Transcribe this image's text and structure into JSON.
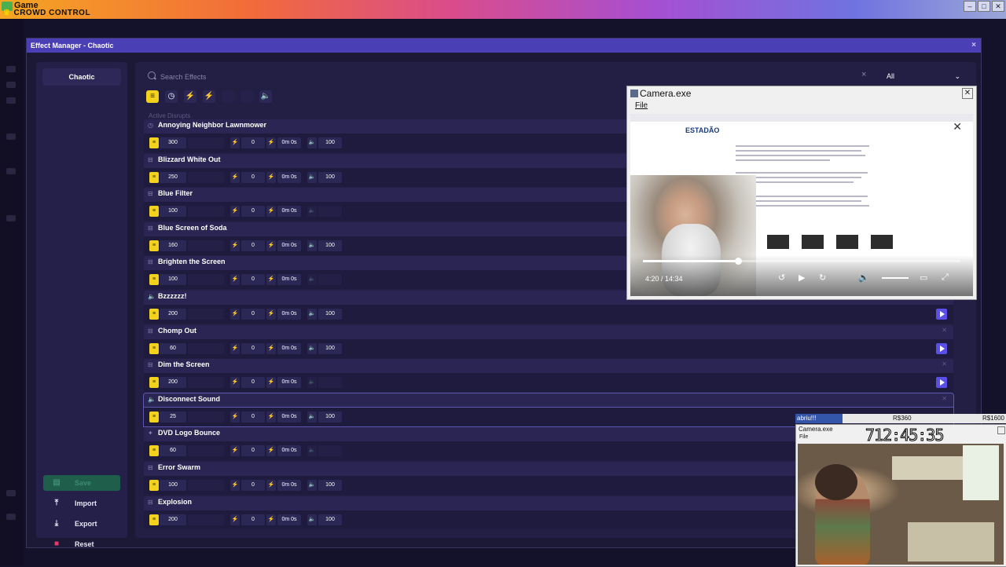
{
  "titlebar": {
    "app_title": "Game",
    "logo_text": "CROWD CONTROL",
    "min": "–",
    "max": "□",
    "close": "✕"
  },
  "effect_manager": {
    "title": "Effect Manager - Chaotic",
    "close_label": "×",
    "mode_label": "Chaotic",
    "search_placeholder": "Search Effects",
    "search_clear": "×",
    "filter_value": "All",
    "section_label": "Active Disrupts",
    "side_actions": {
      "save": "Save",
      "import": "Import",
      "export": "Export",
      "reset": "Reset"
    },
    "rows": [
      {
        "name": "Annoying Neighbor Lawnmower",
        "type_icon": "clock-icon",
        "price": "300",
        "bits": "0",
        "duration": "0m 0s",
        "volume": "100",
        "has_volume": true,
        "has_play": false
      },
      {
        "name": "Blizzard White Out",
        "type_icon": "timer-icon",
        "price": "250",
        "bits": "0",
        "duration": "0m 0s",
        "volume": "100",
        "has_volume": true,
        "has_play": false
      },
      {
        "name": "Blue Filter",
        "type_icon": "timer-icon",
        "price": "100",
        "bits": "0",
        "duration": "0m 0s",
        "volume": "",
        "has_volume": false,
        "has_play": false
      },
      {
        "name": "Blue Screen of Soda",
        "type_icon": "timer-icon",
        "price": "160",
        "bits": "0",
        "duration": "0m 0s",
        "volume": "100",
        "has_volume": true,
        "has_play": false
      },
      {
        "name": "Brighten the Screen",
        "type_icon": "timer-icon",
        "price": "100",
        "bits": "0",
        "duration": "0m 0s",
        "volume": "",
        "has_volume": false,
        "has_play": false
      },
      {
        "name": "Bzzzzzz!",
        "type_icon": "sound-icon",
        "price": "200",
        "bits": "0",
        "duration": "0m 0s",
        "volume": "100",
        "has_volume": true,
        "has_play": true
      },
      {
        "name": "Chomp Out",
        "type_icon": "timer-icon",
        "price": "60",
        "bits": "0",
        "duration": "0m 0s",
        "volume": "100",
        "has_volume": true,
        "has_play": true
      },
      {
        "name": "Dim the Screen",
        "type_icon": "timer-icon",
        "price": "200",
        "bits": "0",
        "duration": "0m 0s",
        "volume": "",
        "has_volume": false,
        "has_play": true
      },
      {
        "name": "Disconnect Sound",
        "type_icon": "sound-icon",
        "price": "25",
        "bits": "0",
        "duration": "0m 0s",
        "volume": "100",
        "has_volume": true,
        "has_play": false
      },
      {
        "name": "DVD Logo Bounce",
        "type_icon": "star-icon",
        "price": "60",
        "bits": "0",
        "duration": "0m 0s",
        "volume": "",
        "has_volume": false,
        "has_play": false
      },
      {
        "name": "Error Swarm",
        "type_icon": "timer-icon",
        "price": "100",
        "bits": "0",
        "duration": "0m 0s",
        "volume": "100",
        "has_volume": true,
        "has_play": false
      },
      {
        "name": "Explosion",
        "type_icon": "timer-icon",
        "price": "200",
        "bits": "0",
        "duration": "0m 0s",
        "volume": "100",
        "has_volume": true,
        "has_play": false
      }
    ]
  },
  "camera_main": {
    "title": "Camera.exe",
    "menu_file": "File",
    "brand_text": "ESTADÃO",
    "time_label": "4:20 / 14:34",
    "progress_fraction": 0.3
  },
  "stream_overlay": {
    "stat_name": "abriu!!!",
    "stat_mid": "R$360",
    "stat_right": "R$1600",
    "cam_title": "Camera.exe",
    "cam_menu": "File",
    "clock": "712:45:35"
  },
  "colors": {
    "accent": "#5a4fe6",
    "coin": "#f2d21c",
    "header": "#4a3fb5"
  }
}
